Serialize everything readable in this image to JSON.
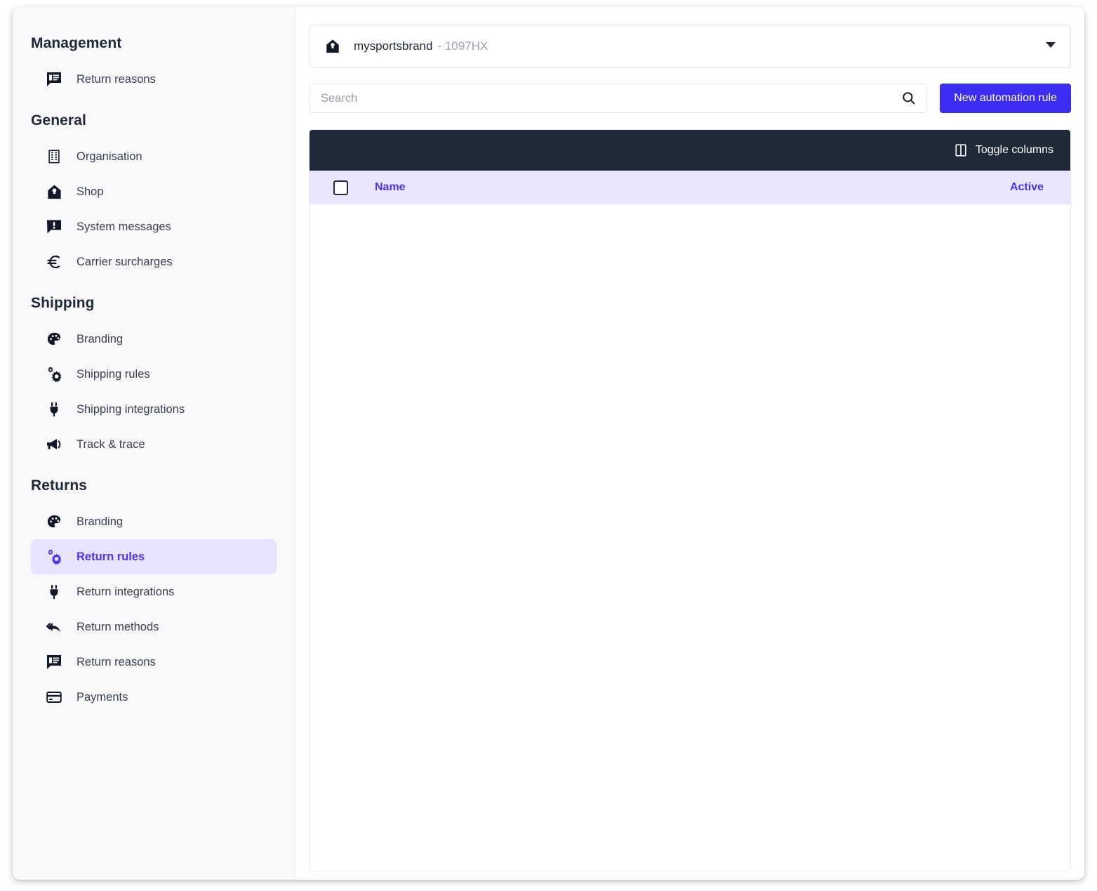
{
  "sidebar": {
    "sections": [
      {
        "title": "Management",
        "items": [
          {
            "label": "Return reasons",
            "icon": "comment-lines-icon",
            "active": false
          }
        ]
      },
      {
        "title": "General",
        "items": [
          {
            "label": "Organisation",
            "icon": "building-icon",
            "active": false
          },
          {
            "label": "Shop",
            "icon": "shop-home-icon",
            "active": false
          },
          {
            "label": "System messages",
            "icon": "comment-alert-icon",
            "active": false
          },
          {
            "label": "Carrier surcharges",
            "icon": "euro-icon",
            "active": false
          }
        ]
      },
      {
        "title": "Shipping",
        "items": [
          {
            "label": "Branding",
            "icon": "palette-icon",
            "active": false
          },
          {
            "label": "Shipping rules",
            "icon": "gears-icon",
            "active": false
          },
          {
            "label": "Shipping integrations",
            "icon": "plug-icon",
            "active": false
          },
          {
            "label": "Track & trace",
            "icon": "megaphone-icon",
            "active": false
          }
        ]
      },
      {
        "title": "Returns",
        "items": [
          {
            "label": "Branding",
            "icon": "palette-icon",
            "active": false
          },
          {
            "label": "Return rules",
            "icon": "gears-icon",
            "active": true
          },
          {
            "label": "Return integrations",
            "icon": "plug-icon",
            "active": false
          },
          {
            "label": "Return methods",
            "icon": "reply-all-icon",
            "active": false
          },
          {
            "label": "Return reasons",
            "icon": "comment-lines-icon",
            "active": false
          },
          {
            "label": "Payments",
            "icon": "credit-card-icon",
            "active": false
          }
        ]
      }
    ]
  },
  "main": {
    "shop_selector": {
      "icon": "shop-home-icon",
      "name": "mysportsbrand",
      "code": "- 1097HX",
      "caret_icon": "chevron-down-icon"
    },
    "search": {
      "placeholder": "Search",
      "value": "",
      "icon": "search-icon"
    },
    "new_rule_button": "New automation rule",
    "table": {
      "toggle_columns_label": "Toggle columns",
      "toggle_columns_icon": "columns-icon",
      "select_all_checkbox": "unchecked",
      "columns": [
        "Name",
        "Active"
      ],
      "rows": []
    }
  },
  "colors": {
    "accent": "#4c33ef",
    "primary_button": "#3c2ef0",
    "toolbar_dark": "#1e2a38",
    "table_header_bg": "#e9e6fb",
    "active_nav_bg": "#e7e3fd",
    "sidebar_bg": "#f9f9fb"
  }
}
